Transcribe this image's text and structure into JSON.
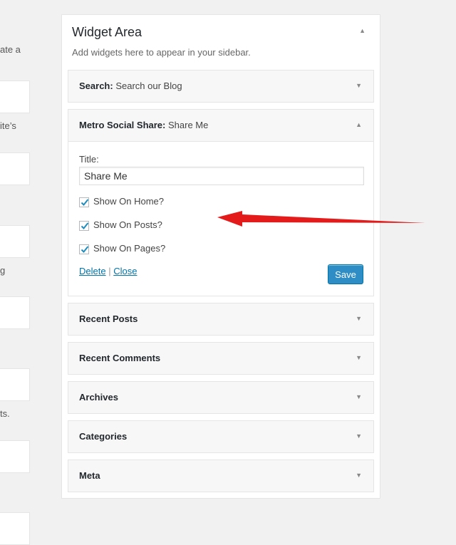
{
  "left_column": {
    "fragments": [
      "ate a",
      "ite’s",
      "g",
      "ts."
    ]
  },
  "widget_area": {
    "title": "Widget Area",
    "description": "Add widgets here to appear in your sidebar."
  },
  "widgets": [
    {
      "name": "Search:",
      "subtitle": "Search our Blog"
    },
    {
      "name": "Metro Social Share:",
      "subtitle": "Share Me"
    },
    {
      "name": "Recent Posts"
    },
    {
      "name": "Recent Comments"
    },
    {
      "name": "Archives"
    },
    {
      "name": "Categories"
    },
    {
      "name": "Meta"
    }
  ],
  "share_form": {
    "title_label": "Title:",
    "title_value": "Share Me",
    "checkboxes": [
      {
        "label": "Show On Home?",
        "checked": true
      },
      {
        "label": "Show On Posts?",
        "checked": true
      },
      {
        "label": "Show On Pages?",
        "checked": true
      }
    ],
    "delete_label": "Delete",
    "separator": "|",
    "close_label": "Close",
    "save_label": "Save"
  },
  "colors": {
    "accent": "#0073aa",
    "save_button": "#2e8dc4",
    "annotation_arrow": "#e31b1b"
  },
  "icons": {
    "collapse": "triangle-up-icon",
    "expand": "triangle-down-icon",
    "checkmark": "check-icon"
  }
}
